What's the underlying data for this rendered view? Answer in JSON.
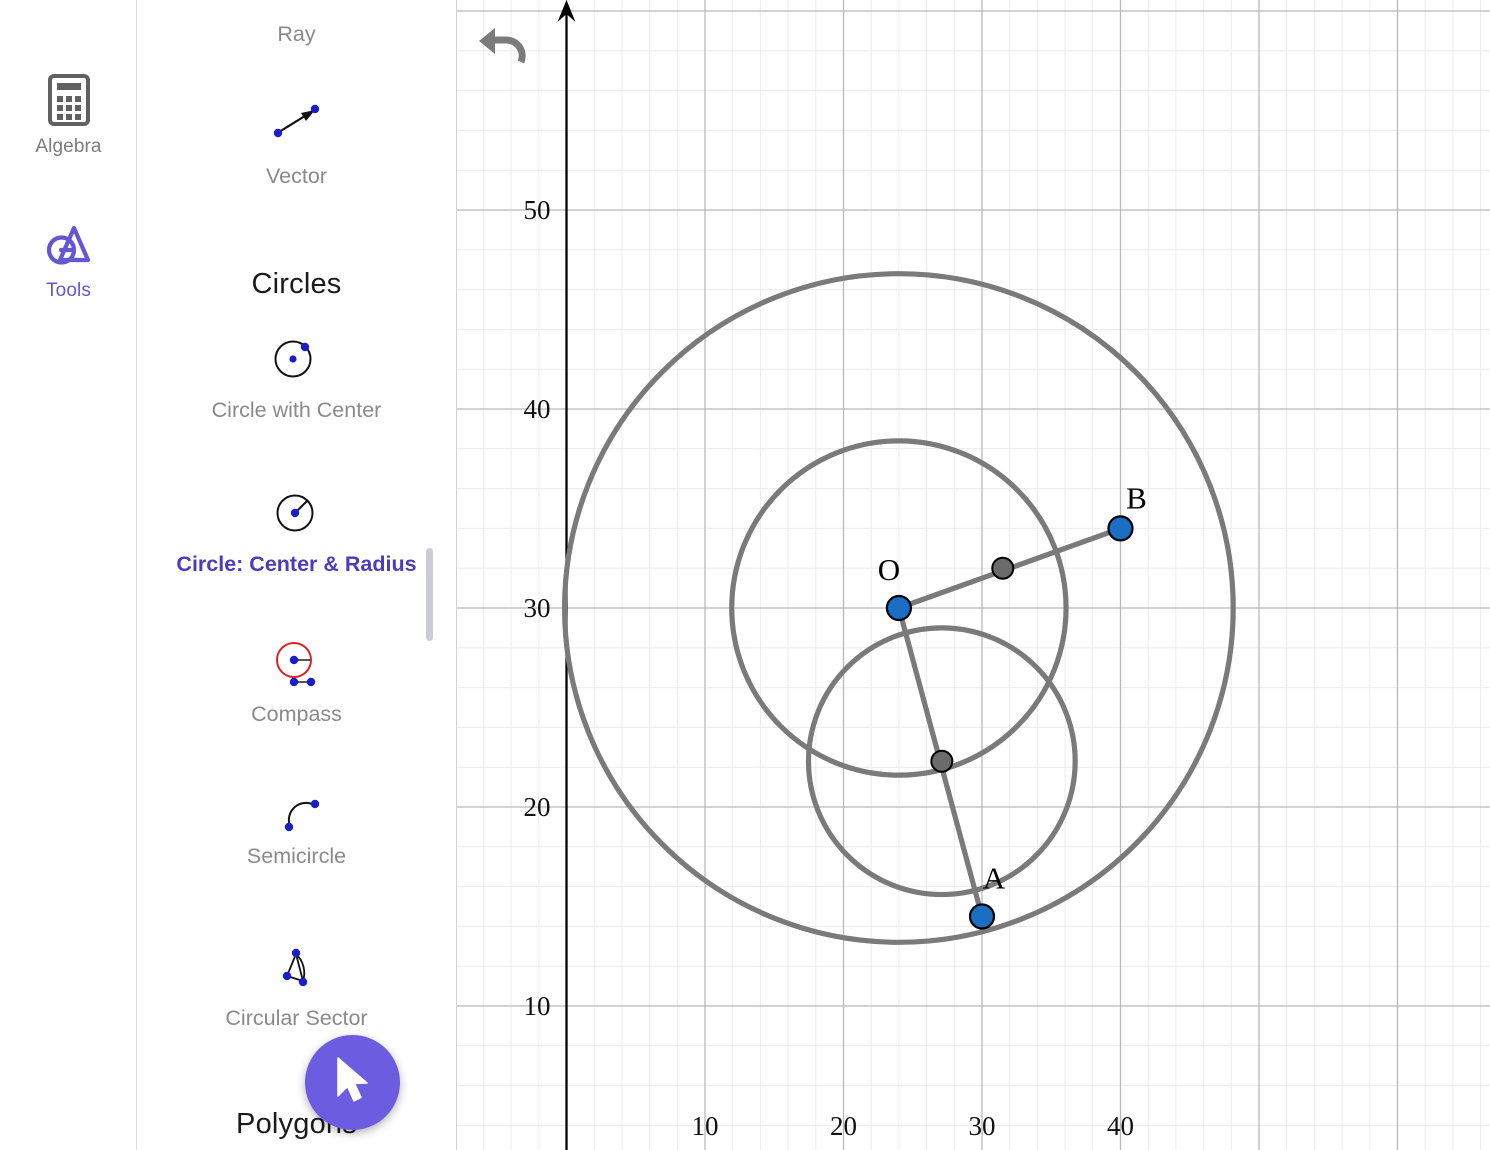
{
  "app": {
    "accent_purple": "#6557d2",
    "fab_purple": "#6c5ce0",
    "point_blue": "#1a6fc4",
    "construction_gray": "#7a7a7a",
    "gray_point": "#6b6b6b"
  },
  "rail": {
    "items": [
      {
        "id": "algebra",
        "label": "Algebra",
        "icon": "calculator-icon",
        "active": false
      },
      {
        "id": "tools",
        "label": "Tools",
        "icon": "geogebra-tools-icon",
        "active": true
      }
    ]
  },
  "toolpanel": {
    "entries": [
      {
        "id": "ray",
        "label": "Ray",
        "icon": "ray-icon",
        "selected": false
      },
      {
        "id": "vector",
        "label": "Vector",
        "icon": "vector-icon",
        "selected": false
      },
      {
        "id": "circle-center",
        "label": "Circle with Center",
        "icon": "circle-with-center-icon",
        "selected": false
      },
      {
        "id": "circle-radius",
        "label": "Circle: Center & Radius",
        "icon": "circle-center-radius-icon",
        "selected": true
      },
      {
        "id": "compass",
        "label": "Compass",
        "icon": "compass-icon",
        "selected": false
      },
      {
        "id": "semicircle",
        "label": "Semicircle",
        "icon": "semicircle-icon",
        "selected": false
      },
      {
        "id": "circular-sector",
        "label": "Circular Sector",
        "icon": "circular-sector-icon",
        "selected": false
      }
    ],
    "groups": [
      {
        "id": "circles",
        "label": "Circles"
      },
      {
        "id": "polygons",
        "label": "Polygons"
      }
    ]
  },
  "fab": {
    "icon": "cursor-arrow-icon",
    "label": "Move"
  },
  "graphics": {
    "undo": {
      "icon": "undo-icon",
      "label": "Undo"
    },
    "x_axis_labels": [
      "10",
      "20",
      "30",
      "40"
    ],
    "y_axis_labels": [
      "10",
      "20",
      "30",
      "40",
      "50"
    ],
    "point_labels": {
      "o": "O",
      "a": "A",
      "b": "B"
    }
  },
  "chart_data": {
    "type": "scatter",
    "title": "",
    "xlabel": "",
    "ylabel": "",
    "xlim": [
      4.6,
      64.9
    ],
    "ylim": [
      2.4,
      60.9
    ],
    "grid": true,
    "minor_grid_step": 2,
    "major_grid_step": 10,
    "xticks": [
      10,
      20,
      30,
      40
    ],
    "yticks": [
      10,
      20,
      30,
      40,
      50
    ],
    "points": [
      {
        "name": "O",
        "x": 24,
        "y": 30,
        "color": "#1a6fc4",
        "label_dx": -10,
        "label_dy": -28
      },
      {
        "name": "A",
        "x": 30,
        "y": 14.5,
        "color": "#1a6fc4",
        "label_dx": 12,
        "label_dy": -28
      },
      {
        "name": "B",
        "x": 40,
        "y": 34,
        "color": "#1a6fc4",
        "label_dx": 16,
        "label_dy": -20
      },
      {
        "name": "",
        "x": 31.5,
        "y": 32,
        "color": "#6b6b6b",
        "label_dx": 0,
        "label_dy": 0
      },
      {
        "name": "",
        "x": 27.1,
        "y": 22.3,
        "color": "#6b6b6b",
        "label_dx": 0,
        "label_dy": 0
      }
    ],
    "circles": [
      {
        "name": "outer",
        "cx": 24,
        "cy": 30,
        "r": 16.8,
        "color": "#7a7a7a"
      },
      {
        "name": "middle",
        "cx": 24,
        "cy": 30,
        "r": 8.4,
        "color": "#7a7a7a"
      },
      {
        "name": "inner",
        "cx": 27.1,
        "cy": 22.3,
        "r": 6.7,
        "color": "#7a7a7a"
      }
    ],
    "segments": [
      {
        "name": "OB",
        "x1": 24,
        "y1": 30,
        "x2": 40,
        "y2": 34,
        "color": "#7a7a7a"
      },
      {
        "name": "OA",
        "x1": 24,
        "y1": 30,
        "x2": 30,
        "y2": 14.5,
        "color": "#7a7a7a"
      }
    ]
  }
}
